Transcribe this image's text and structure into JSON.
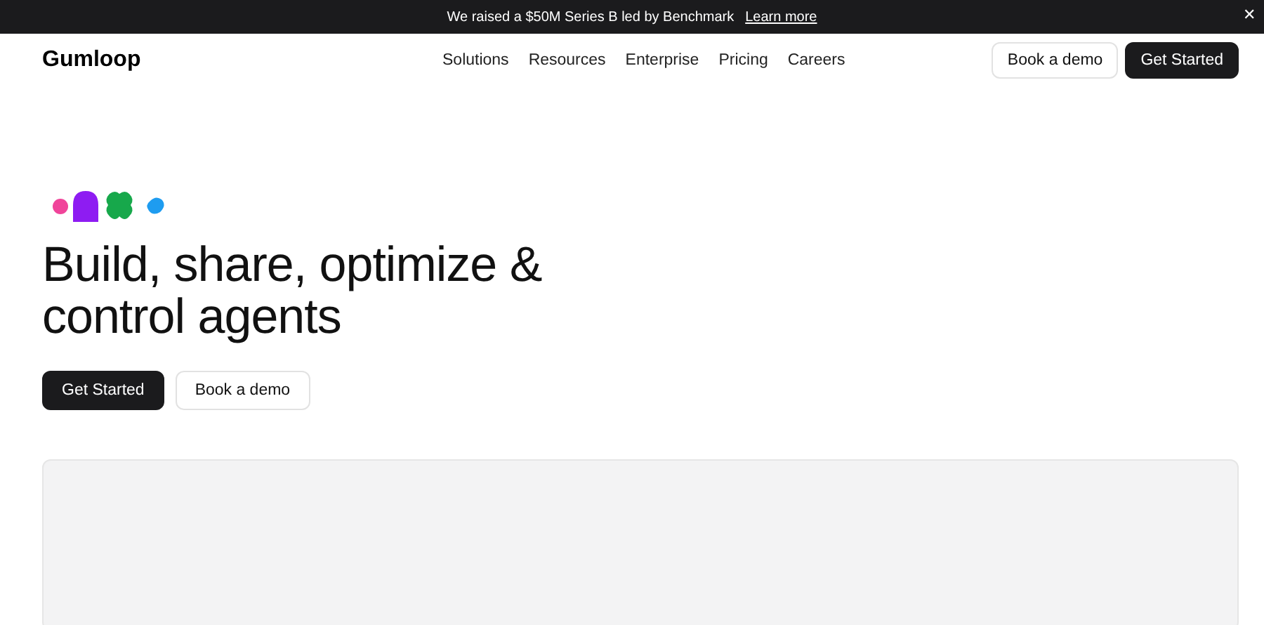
{
  "banner": {
    "text": "We raised a $50M Series B led by Benchmark",
    "link": "Learn more",
    "close": "✕"
  },
  "nav": {
    "logo": "Gumloop",
    "links": [
      "Solutions",
      "Resources",
      "Enterprise",
      "Pricing",
      "Careers"
    ],
    "secondary_button": "Book a demo",
    "primary_button": "Get Started"
  },
  "hero": {
    "headline": "Build, share, optimize & control agents",
    "primary_button": "Get Started",
    "secondary_button": "Book a demo"
  }
}
